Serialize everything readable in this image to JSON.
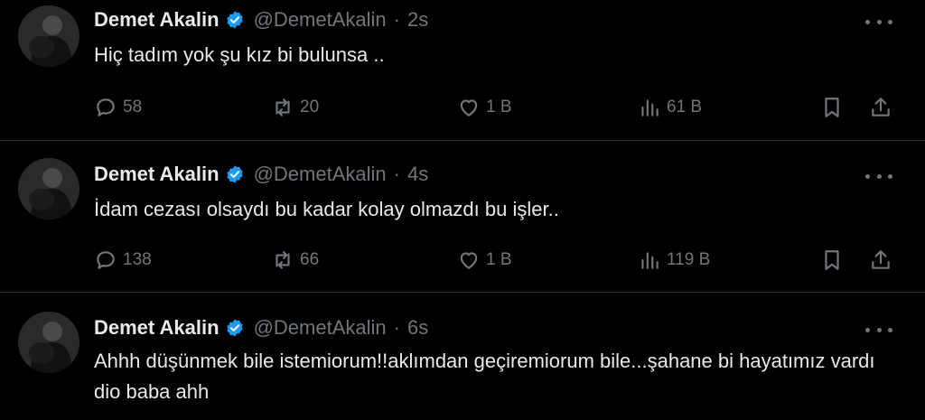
{
  "tweets": [
    {
      "author": "Demet Akalin",
      "handle": "@DemetAkalin",
      "separator": "·",
      "time": "2s",
      "text": "Hiç tadım yok şu kız bi bulunsa ..",
      "replies": "58",
      "retweets": "20",
      "likes": "1 B",
      "views": "61 B"
    },
    {
      "author": "Demet Akalin",
      "handle": "@DemetAkalin",
      "separator": "·",
      "time": "4s",
      "text": "İdam cezası olsaydı bu kadar kolay olmazdı bu işler..",
      "replies": "138",
      "retweets": "66",
      "likes": "1 B",
      "views": "119 B"
    },
    {
      "author": "Demet Akalin",
      "handle": "@DemetAkalin",
      "separator": "·",
      "time": "6s",
      "text": "Ahhh düşünmek bile istemiorum!!aklımdan geçiremiorum bile...şahane bi hayatımız vardı dio baba ahh"
    }
  ],
  "colors": {
    "background": "#000000",
    "text": "#e7e9ea",
    "muted": "#71767b",
    "verified": "#1d9bf0",
    "divider": "#2f3336"
  },
  "icons": [
    "reply-icon",
    "retweet-icon",
    "like-icon",
    "views-icon",
    "bookmark-icon",
    "share-icon",
    "verified-icon",
    "more-icon"
  ]
}
